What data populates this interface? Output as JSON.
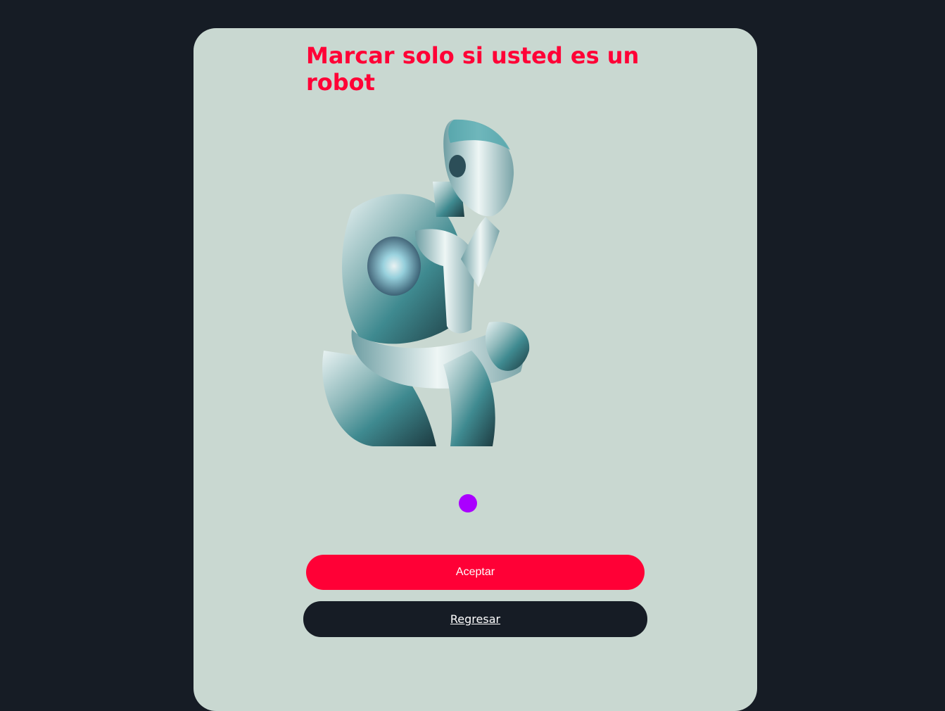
{
  "page": {
    "background_color": "#161c25",
    "card_color": "#c9d8d1"
  },
  "header": {
    "title": "Marcar solo si usted es un robot",
    "title_color": "#ff0036"
  },
  "illustration": {
    "icon": "thinking-robot-image",
    "alt": "robot"
  },
  "choice": {
    "icon": "radio-button",
    "color": "#aa00ff"
  },
  "actions": {
    "accept_label": "Aceptar",
    "accept_color": "#ff0036",
    "back_label": "Regresar",
    "back_color": "#161c25"
  }
}
